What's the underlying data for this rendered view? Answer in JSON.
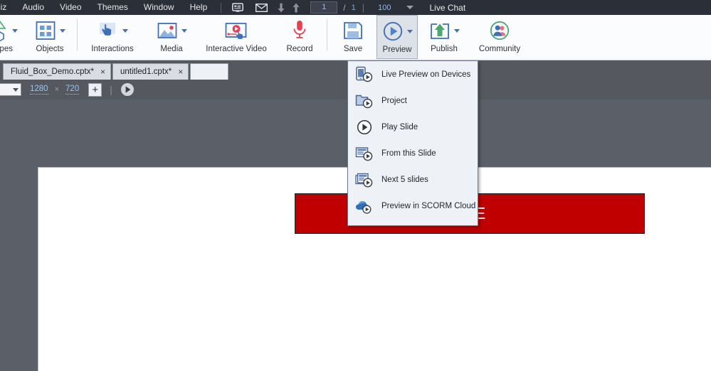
{
  "menubar": {
    "items": [
      {
        "label": "iiz",
        "name": "menu-quiz"
      },
      {
        "label": "Audio",
        "name": "menu-audio"
      },
      {
        "label": "Video",
        "name": "menu-video"
      },
      {
        "label": "Themes",
        "name": "menu-themes"
      },
      {
        "label": "Window",
        "name": "menu-window"
      },
      {
        "label": "Help",
        "name": "menu-help"
      }
    ],
    "icons": [
      {
        "name": "panel-icon"
      },
      {
        "name": "mail-icon"
      },
      {
        "name": "arrow-down-icon"
      },
      {
        "name": "arrow-up-icon"
      }
    ],
    "page_current": "1",
    "page_divider": "/",
    "page_total": "1",
    "divider": "|",
    "zoom": "100",
    "live_chat": "Live Chat"
  },
  "ribbon": {
    "buttons": [
      {
        "label": "apes",
        "name": "shapes-button",
        "icon": "shapes-icon",
        "caret": true
      },
      {
        "label": "Objects",
        "name": "objects-button",
        "icon": "objects-icon",
        "caret": true
      },
      {
        "label": "Interactions",
        "name": "interactions-button",
        "icon": "interactions-icon",
        "caret": true
      },
      {
        "label": "Media",
        "name": "media-button",
        "icon": "media-icon",
        "caret": true
      },
      {
        "label": "Interactive Video",
        "name": "interactive-video-button",
        "icon": "interactive-video-icon",
        "caret": false
      },
      {
        "label": "Record",
        "name": "record-button",
        "icon": "microphone-icon",
        "caret": false
      },
      {
        "label": "Save",
        "name": "save-button",
        "icon": "floppy-disk-icon",
        "caret": false
      },
      {
        "label": "Preview",
        "name": "preview-button",
        "icon": "play-circle-icon",
        "caret": true
      },
      {
        "label": "Publish",
        "name": "publish-button",
        "icon": "publish-upload-icon",
        "caret": true
      },
      {
        "label": "Community",
        "name": "community-button",
        "icon": "people-icon",
        "caret": false
      }
    ]
  },
  "doctabs": {
    "tabs": [
      {
        "label": "Fluid_Box_Demo.cptx*",
        "close": "×",
        "name": "document-tab-fluid-box-demo"
      },
      {
        "label": "untitled1.cptx*",
        "close": "×",
        "name": "document-tab-untitled1"
      }
    ]
  },
  "subbar": {
    "width": "1280",
    "x_symbol": "×",
    "height": "720",
    "add": "+",
    "divider": "|"
  },
  "canvas": {
    "shape_text": "E"
  },
  "dropdown": {
    "items": [
      {
        "label": "Live Preview on Devices",
        "icon": "device-preview-icon",
        "name": "menu-item-live-preview-on-devices"
      },
      {
        "label": "Project",
        "icon": "folder-preview-icon",
        "name": "menu-item-project"
      },
      {
        "label": "Play Slide",
        "icon": "play-circle-icon",
        "name": "menu-item-play-slide"
      },
      {
        "label": "From this Slide",
        "icon": "slide-preview-icon",
        "name": "menu-item-from-this-slide"
      },
      {
        "label": "Next 5 slides",
        "icon": "slides-stack-preview-icon",
        "name": "menu-item-next-5-slides"
      },
      {
        "label": "Preview in SCORM Cloud",
        "icon": "cloud-preview-icon",
        "name": "menu-item-preview-in-scorm-cloud"
      }
    ]
  },
  "colors": {
    "menubar_bg": "#2b2f38",
    "ribbon_bg": "#fbfcfe",
    "workspace_bg": "#5b5f67",
    "shape_fill": "#c00000",
    "accent_blue": "#3f6fb5",
    "accent_red": "#e8404f",
    "accent_green": "#4aa870"
  }
}
